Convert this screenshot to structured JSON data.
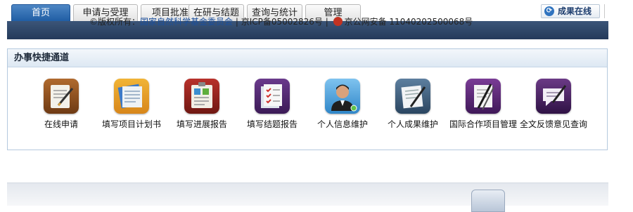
{
  "tabs": [
    {
      "label": "首页",
      "active": true
    },
    {
      "label": "申请与受理"
    },
    {
      "label": "项目批准"
    },
    {
      "label": "在研与结题"
    },
    {
      "label": "查询与统计"
    },
    {
      "label": "管理"
    }
  ],
  "online_button": {
    "label": "成果在线",
    "icon": "refresh-icon"
  },
  "panel": {
    "title": "办事快捷通道",
    "items": [
      {
        "label": "在线申请",
        "icon": "online-application-icon"
      },
      {
        "label": "填写项目计划书",
        "icon": "project-plan-icon"
      },
      {
        "label": "填写进展报告",
        "icon": "progress-report-icon"
      },
      {
        "label": "填写结题报告",
        "icon": "final-report-icon"
      },
      {
        "label": "个人信息维护",
        "icon": "user-profile-icon"
      },
      {
        "label": "个人成果维护",
        "icon": "achievements-icon"
      },
      {
        "label": "国际合作项目管理",
        "icon": "international-cooperation-icon"
      },
      {
        "label": "全文反馈意见查询",
        "icon": "feedback-query-icon"
      }
    ]
  },
  "footer": {
    "copyright_prefix": "©版权所有：",
    "org_link": "国家自然科学基金委员会",
    "sep1": " | ",
    "icp": "京ICP备05002826号",
    "sep2": " | ",
    "police": "京公网安备 11040202500068号"
  },
  "colors": {
    "tab_active": "#2a66ad",
    "nav_band": "#2d4568",
    "panel_border": "#b4c9de",
    "link": "#1b4f9c"
  }
}
